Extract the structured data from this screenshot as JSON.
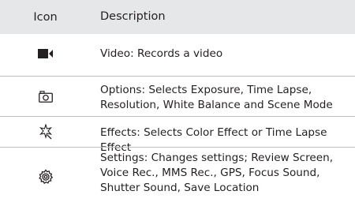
{
  "header": {
    "icon_label": "Icon",
    "description_label": "Description"
  },
  "rows": [
    {
      "icon": "video-camera-icon",
      "description": "Video: Records a video"
    },
    {
      "icon": "camera-icon",
      "description": "Options: Selects Exposure, Time Lapse, Resolution, White Balance and Scene Mode"
    },
    {
      "icon": "sparkle-effects-icon",
      "description": "Effects: Selects Color Effect or Time Lapse Effect"
    },
    {
      "icon": "gear-icon",
      "description": "Settings: Changes settings; Review Screen, Voice Rec., MMS Rec., GPS, Focus Sound, Shutter Sound, Save Location"
    }
  ],
  "colors": {
    "header_background": "#e6e7e8",
    "divider": "#bcbec0",
    "text": "#231f20"
  }
}
